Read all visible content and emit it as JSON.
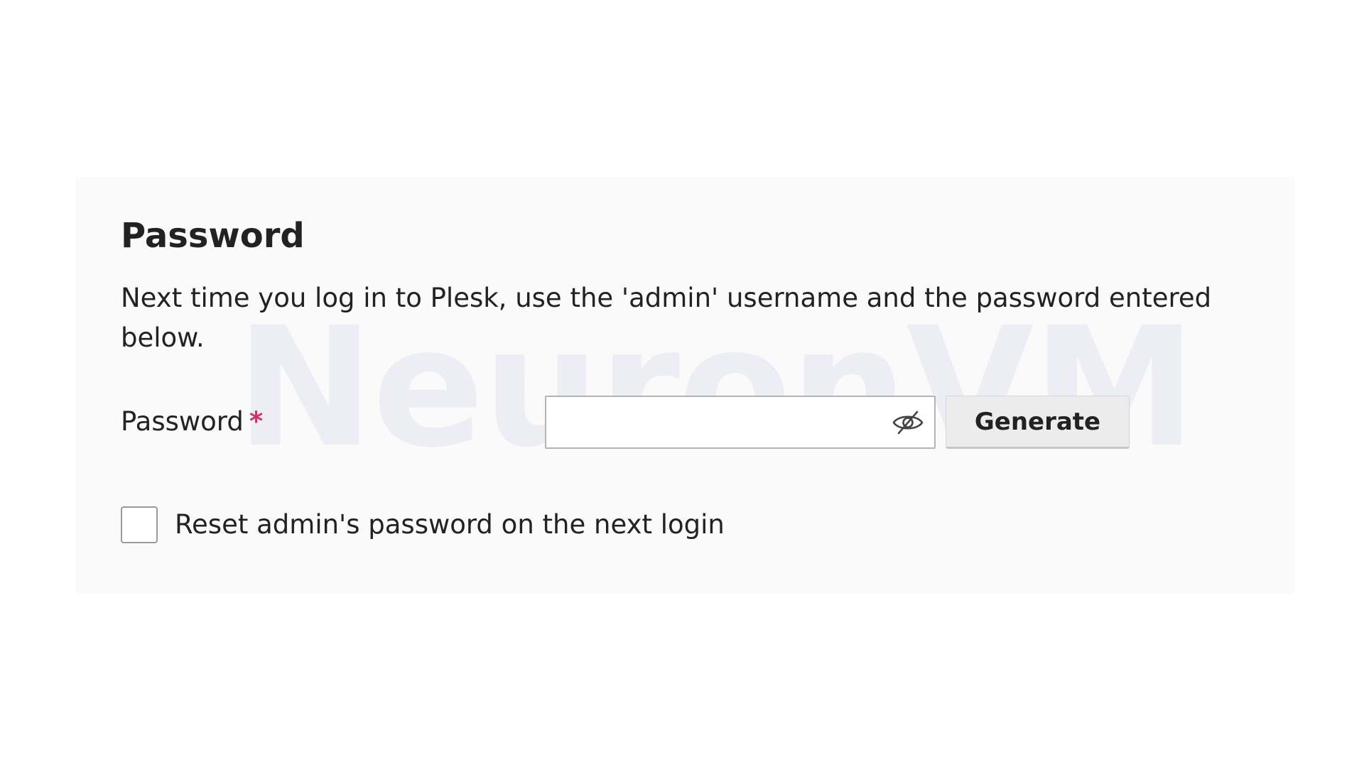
{
  "watermark": {
    "text": "NeuronVM"
  },
  "section": {
    "title": "Password",
    "description": "Next time you log in to Plesk, use the 'admin' username and the password entered below."
  },
  "password_field": {
    "label": "Password",
    "required_mark": "*",
    "value": "",
    "toggle_icon": "eye-slash-icon"
  },
  "generate_button": {
    "label": "Generate"
  },
  "reset_option": {
    "label": "Reset admin's password on the next login",
    "checked": false
  },
  "colors": {
    "panel_background": "#fafafa",
    "required_accent": "#d0306b",
    "watermark": "#ecedf5",
    "button_background": "#ececec"
  }
}
